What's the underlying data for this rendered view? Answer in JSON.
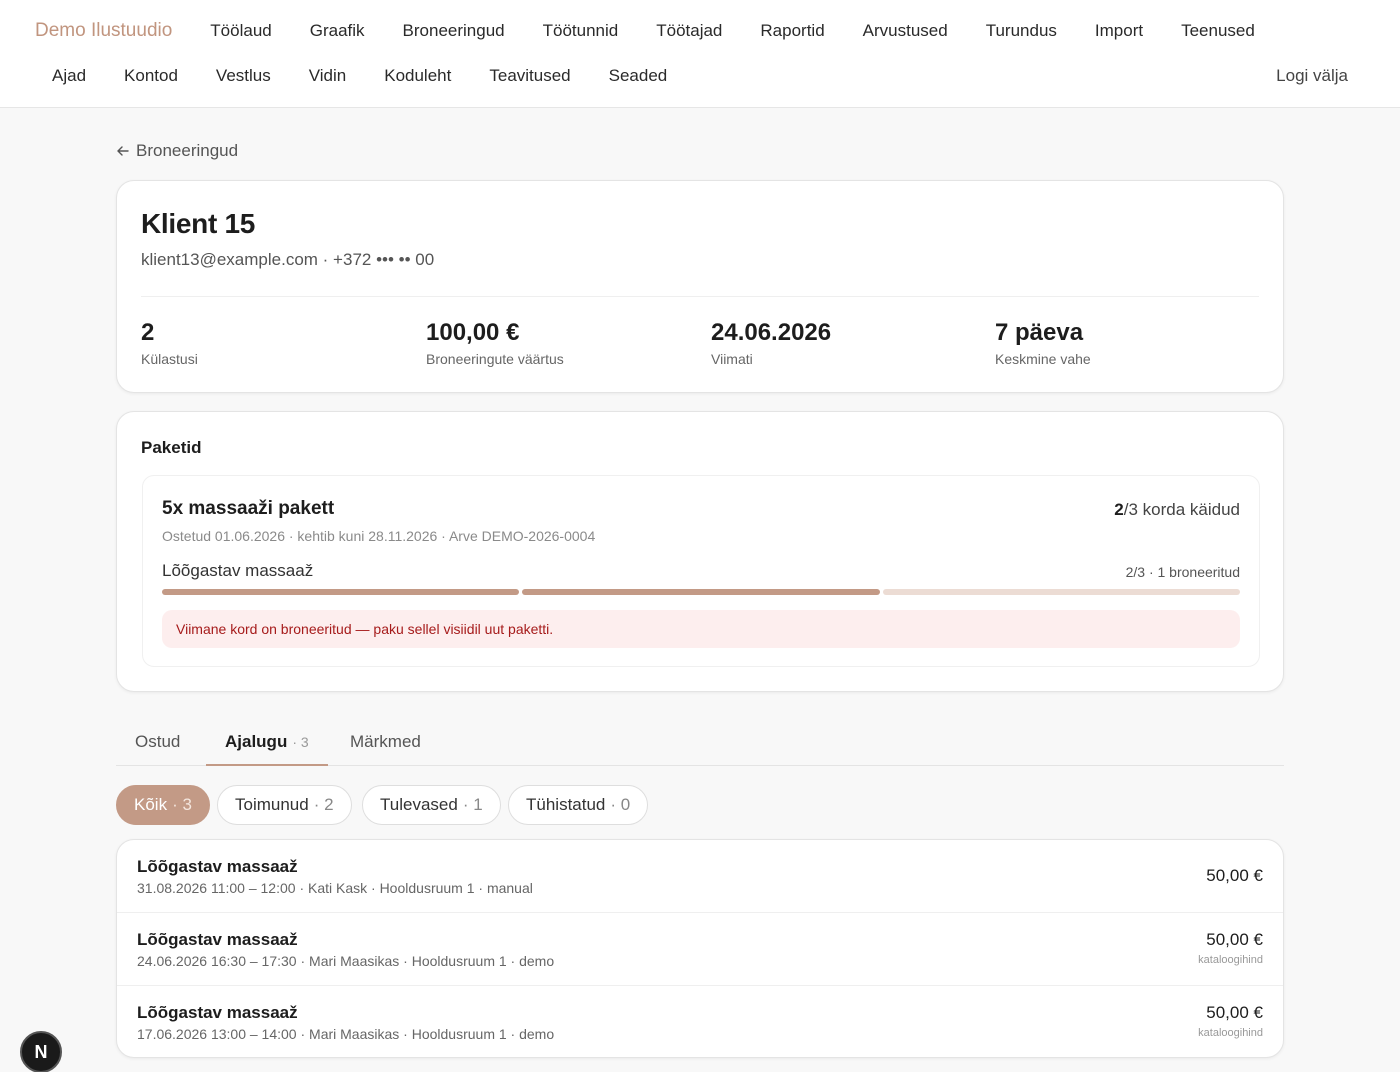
{
  "nav": {
    "brand": "Demo Ilustuudio",
    "row1": [
      "Töölaud",
      "Graafik",
      "Broneeringud",
      "Töötunnid",
      "Töötajad",
      "Raportid",
      "Arvustused",
      "Turundus",
      "Import",
      "Teenused"
    ],
    "row2": [
      "Ajad",
      "Kontod",
      "Vestlus",
      "Vidin",
      "Koduleht",
      "Teavitused",
      "Seaded"
    ],
    "logout": "Logi välja"
  },
  "back": {
    "label": "Broneeringud"
  },
  "client": {
    "name": "Klient 15",
    "contact": "klient13@example.com · +372 ••• •• 00",
    "stats": [
      {
        "value": "2",
        "label": "Külastusi"
      },
      {
        "value": "100,00 €",
        "label": "Broneeringute väärtus"
      },
      {
        "value": "24.06.2026",
        "label": "Viimati"
      },
      {
        "value": "7 päeva",
        "label": "Keskmine vahe"
      }
    ]
  },
  "packages": {
    "title": "Paketid",
    "item": {
      "name": "5x massaaži pakett",
      "used": "2",
      "count_suffix": "/3 korda käidud",
      "meta": "Ostetud 01.06.2026 · kehtib kuni 28.11.2026 · Arve DEMO-2026-0004",
      "service": "Lõõgastav massaaž",
      "service_count": "2/3 · 1 broneeritud",
      "progress": {
        "used": 2,
        "total": 3
      },
      "alert": "Viimane kord on broneeritud — paku sellel visiidil uut paketti."
    }
  },
  "tabs": [
    {
      "label": "Ostud",
      "count": ""
    },
    {
      "label": "Ajalugu",
      "count": "· 3"
    },
    {
      "label": "Märkmed",
      "count": ""
    }
  ],
  "filters": [
    {
      "label": "Kõik",
      "count": "· 3"
    },
    {
      "label": "Toimunud",
      "count": "· 2"
    },
    {
      "label": "Tulevased",
      "count": "· 1"
    },
    {
      "label": "Tühistatud",
      "count": "· 0"
    }
  ],
  "bookings": [
    {
      "title": "Lõõgastav massaaž",
      "meta": "31.08.2026 11:00 – 12:00 · Kati Kask · Hooldusruum 1 · manual",
      "price": "50,00 €",
      "note": ""
    },
    {
      "title": "Lõõgastav massaaž",
      "meta": "24.06.2026 16:30 – 17:30 · Mari Maasikas · Hooldusruum 1 · demo",
      "price": "50,00 €",
      "note": "kataloogihind"
    },
    {
      "title": "Lõõgastav massaaž",
      "meta": "17.06.2026 13:00 – 14:00 · Mari Maasikas · Hooldusruum 1 · demo",
      "price": "50,00 €",
      "note": "kataloogihind"
    }
  ],
  "floating_button": {
    "label": "N"
  },
  "colors": {
    "accent": "#c39a86",
    "brand": "#c1957f",
    "alert_text": "#a61b1b",
    "alert_bg": "#fdeeee"
  }
}
